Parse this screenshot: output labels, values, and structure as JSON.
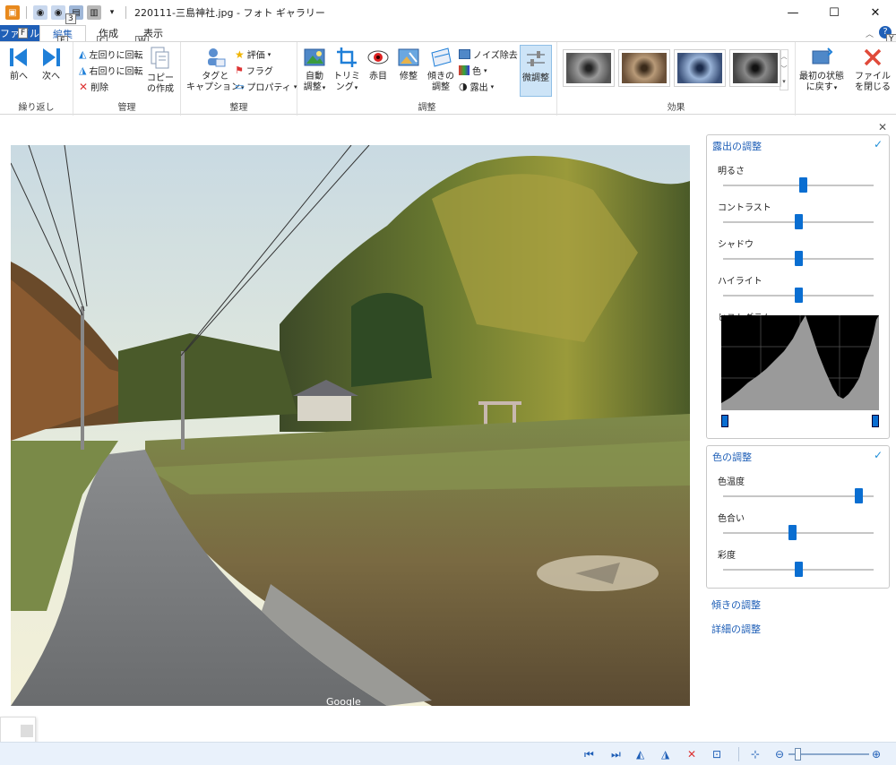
{
  "window": {
    "title": "220111-三島神社.jpg - フォト ギャラリー",
    "qa_keytip": "3"
  },
  "tabs": [
    {
      "label": "ファイル",
      "keytip": "F"
    },
    {
      "label": "編集",
      "keytip": "E"
    },
    {
      "label": "作成",
      "keytip": "C"
    },
    {
      "label": "表示",
      "keytip": "W"
    }
  ],
  "help_keytip": "Y",
  "ribbon": {
    "groups": {
      "nav": {
        "label": "繰り返し",
        "prev": "前へ",
        "next": "次へ"
      },
      "manage": {
        "label": "管理",
        "rotate_left": "左回りに回転",
        "rotate_right": "右回りに回転",
        "delete": "削除",
        "copy_line1": "コピー",
        "copy_line2": "の作成"
      },
      "organize": {
        "label": "整理",
        "tag_line1": "タグと",
        "tag_line2": "キャプション",
        "rating": "評価",
        "flag": "フラグ",
        "properties": "プロパティ"
      },
      "adjust": {
        "label": "調整",
        "auto_line1": "自動",
        "auto_line2": "調整",
        "trim_line1": "トリミ",
        "trim_line2": "ング",
        "redeye": "赤目",
        "retouch": "修整",
        "tilt_line1": "傾きの",
        "tilt_line2": "調整",
        "noise": "ノイズ除去",
        "color": "色",
        "exposure": "露出",
        "fine": "微調整"
      },
      "effects": {
        "label": "効果"
      },
      "revert": {
        "line1": "最初の状態",
        "line2": "に戻す"
      },
      "close": {
        "line1": "ファイル",
        "line2": "を閉じる"
      }
    }
  },
  "photo": {
    "watermark": "Google"
  },
  "panel": {
    "exposure": {
      "title": "露出の調整",
      "check": "✓",
      "sliders": [
        {
          "label": "明るさ",
          "value": 0.53
        },
        {
          "label": "コントラスト",
          "value": 0.5
        },
        {
          "label": "シャドウ",
          "value": 0.5
        },
        {
          "label": "ハイライト",
          "value": 0.5
        }
      ],
      "histogram_label": "ヒストグラム"
    },
    "color": {
      "title": "色の調整",
      "check": "✓",
      "sliders": [
        {
          "label": "色温度",
          "value": 0.9
        },
        {
          "label": "色合い",
          "value": 0.46
        },
        {
          "label": "彩度",
          "value": 0.5
        }
      ]
    },
    "links": [
      "傾きの調整",
      "詳細の調整"
    ]
  },
  "bottombar": {
    "zoom_value": 0.12
  },
  "colors": {
    "accent": "#1f5fb7",
    "thumb": "#0a6ed1"
  }
}
